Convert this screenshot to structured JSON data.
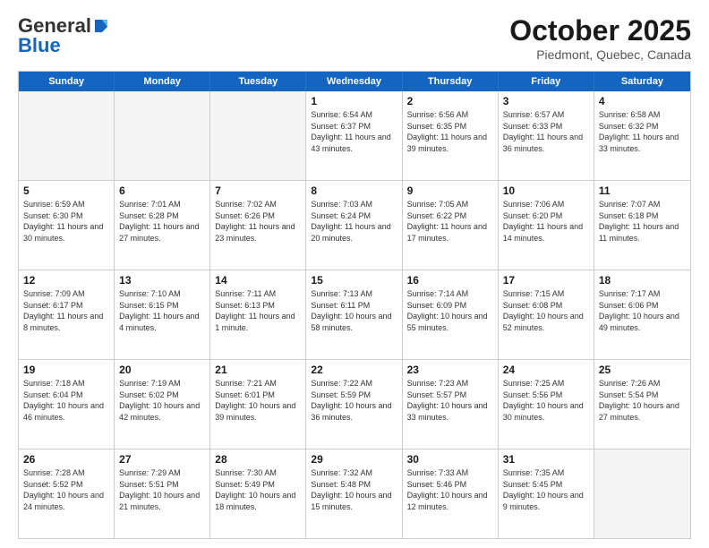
{
  "header": {
    "logo_general": "General",
    "logo_blue": "Blue",
    "month_title": "October 2025",
    "location": "Piedmont, Quebec, Canada"
  },
  "day_headers": [
    "Sunday",
    "Monday",
    "Tuesday",
    "Wednesday",
    "Thursday",
    "Friday",
    "Saturday"
  ],
  "rows": [
    [
      {
        "day": "",
        "empty": true
      },
      {
        "day": "",
        "empty": true
      },
      {
        "day": "",
        "empty": true
      },
      {
        "day": "1",
        "sunrise": "Sunrise: 6:54 AM",
        "sunset": "Sunset: 6:37 PM",
        "daylight": "Daylight: 11 hours and 43 minutes."
      },
      {
        "day": "2",
        "sunrise": "Sunrise: 6:56 AM",
        "sunset": "Sunset: 6:35 PM",
        "daylight": "Daylight: 11 hours and 39 minutes."
      },
      {
        "day": "3",
        "sunrise": "Sunrise: 6:57 AM",
        "sunset": "Sunset: 6:33 PM",
        "daylight": "Daylight: 11 hours and 36 minutes."
      },
      {
        "day": "4",
        "sunrise": "Sunrise: 6:58 AM",
        "sunset": "Sunset: 6:32 PM",
        "daylight": "Daylight: 11 hours and 33 minutes."
      }
    ],
    [
      {
        "day": "5",
        "sunrise": "Sunrise: 6:59 AM",
        "sunset": "Sunset: 6:30 PM",
        "daylight": "Daylight: 11 hours and 30 minutes."
      },
      {
        "day": "6",
        "sunrise": "Sunrise: 7:01 AM",
        "sunset": "Sunset: 6:28 PM",
        "daylight": "Daylight: 11 hours and 27 minutes."
      },
      {
        "day": "7",
        "sunrise": "Sunrise: 7:02 AM",
        "sunset": "Sunset: 6:26 PM",
        "daylight": "Daylight: 11 hours and 23 minutes."
      },
      {
        "day": "8",
        "sunrise": "Sunrise: 7:03 AM",
        "sunset": "Sunset: 6:24 PM",
        "daylight": "Daylight: 11 hours and 20 minutes."
      },
      {
        "day": "9",
        "sunrise": "Sunrise: 7:05 AM",
        "sunset": "Sunset: 6:22 PM",
        "daylight": "Daylight: 11 hours and 17 minutes."
      },
      {
        "day": "10",
        "sunrise": "Sunrise: 7:06 AM",
        "sunset": "Sunset: 6:20 PM",
        "daylight": "Daylight: 11 hours and 14 minutes."
      },
      {
        "day": "11",
        "sunrise": "Sunrise: 7:07 AM",
        "sunset": "Sunset: 6:18 PM",
        "daylight": "Daylight: 11 hours and 11 minutes."
      }
    ],
    [
      {
        "day": "12",
        "sunrise": "Sunrise: 7:09 AM",
        "sunset": "Sunset: 6:17 PM",
        "daylight": "Daylight: 11 hours and 8 minutes."
      },
      {
        "day": "13",
        "sunrise": "Sunrise: 7:10 AM",
        "sunset": "Sunset: 6:15 PM",
        "daylight": "Daylight: 11 hours and 4 minutes."
      },
      {
        "day": "14",
        "sunrise": "Sunrise: 7:11 AM",
        "sunset": "Sunset: 6:13 PM",
        "daylight": "Daylight: 11 hours and 1 minute."
      },
      {
        "day": "15",
        "sunrise": "Sunrise: 7:13 AM",
        "sunset": "Sunset: 6:11 PM",
        "daylight": "Daylight: 10 hours and 58 minutes."
      },
      {
        "day": "16",
        "sunrise": "Sunrise: 7:14 AM",
        "sunset": "Sunset: 6:09 PM",
        "daylight": "Daylight: 10 hours and 55 minutes."
      },
      {
        "day": "17",
        "sunrise": "Sunrise: 7:15 AM",
        "sunset": "Sunset: 6:08 PM",
        "daylight": "Daylight: 10 hours and 52 minutes."
      },
      {
        "day": "18",
        "sunrise": "Sunrise: 7:17 AM",
        "sunset": "Sunset: 6:06 PM",
        "daylight": "Daylight: 10 hours and 49 minutes."
      }
    ],
    [
      {
        "day": "19",
        "sunrise": "Sunrise: 7:18 AM",
        "sunset": "Sunset: 6:04 PM",
        "daylight": "Daylight: 10 hours and 46 minutes."
      },
      {
        "day": "20",
        "sunrise": "Sunrise: 7:19 AM",
        "sunset": "Sunset: 6:02 PM",
        "daylight": "Daylight: 10 hours and 42 minutes."
      },
      {
        "day": "21",
        "sunrise": "Sunrise: 7:21 AM",
        "sunset": "Sunset: 6:01 PM",
        "daylight": "Daylight: 10 hours and 39 minutes."
      },
      {
        "day": "22",
        "sunrise": "Sunrise: 7:22 AM",
        "sunset": "Sunset: 5:59 PM",
        "daylight": "Daylight: 10 hours and 36 minutes."
      },
      {
        "day": "23",
        "sunrise": "Sunrise: 7:23 AM",
        "sunset": "Sunset: 5:57 PM",
        "daylight": "Daylight: 10 hours and 33 minutes."
      },
      {
        "day": "24",
        "sunrise": "Sunrise: 7:25 AM",
        "sunset": "Sunset: 5:56 PM",
        "daylight": "Daylight: 10 hours and 30 minutes."
      },
      {
        "day": "25",
        "sunrise": "Sunrise: 7:26 AM",
        "sunset": "Sunset: 5:54 PM",
        "daylight": "Daylight: 10 hours and 27 minutes."
      }
    ],
    [
      {
        "day": "26",
        "sunrise": "Sunrise: 7:28 AM",
        "sunset": "Sunset: 5:52 PM",
        "daylight": "Daylight: 10 hours and 24 minutes."
      },
      {
        "day": "27",
        "sunrise": "Sunrise: 7:29 AM",
        "sunset": "Sunset: 5:51 PM",
        "daylight": "Daylight: 10 hours and 21 minutes."
      },
      {
        "day": "28",
        "sunrise": "Sunrise: 7:30 AM",
        "sunset": "Sunset: 5:49 PM",
        "daylight": "Daylight: 10 hours and 18 minutes."
      },
      {
        "day": "29",
        "sunrise": "Sunrise: 7:32 AM",
        "sunset": "Sunset: 5:48 PM",
        "daylight": "Daylight: 10 hours and 15 minutes."
      },
      {
        "day": "30",
        "sunrise": "Sunrise: 7:33 AM",
        "sunset": "Sunset: 5:46 PM",
        "daylight": "Daylight: 10 hours and 12 minutes."
      },
      {
        "day": "31",
        "sunrise": "Sunrise: 7:35 AM",
        "sunset": "Sunset: 5:45 PM",
        "daylight": "Daylight: 10 hours and 9 minutes."
      },
      {
        "day": "",
        "empty": true
      }
    ]
  ]
}
